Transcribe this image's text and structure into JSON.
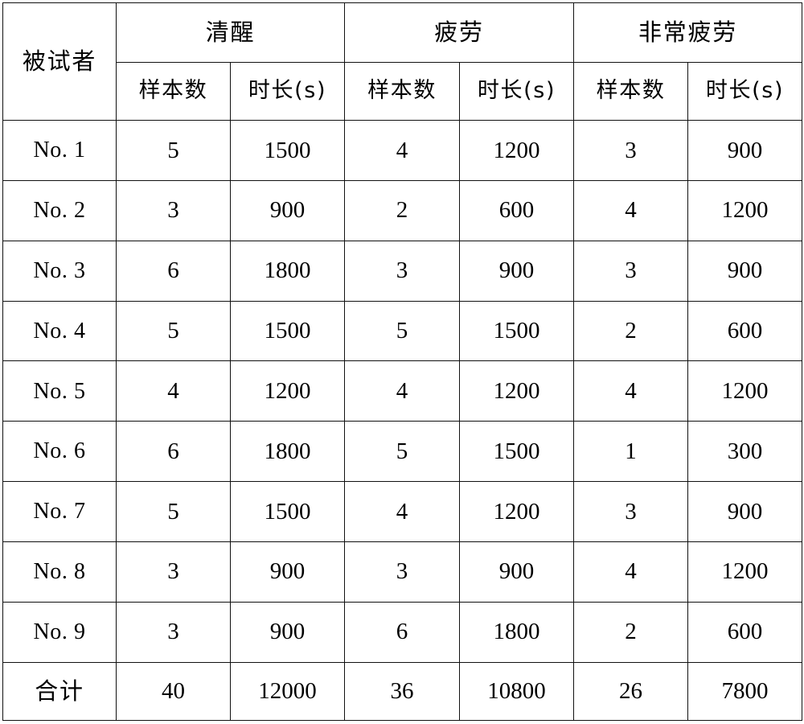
{
  "table": {
    "subject_header": "被试者",
    "groups": [
      {
        "label": "清醒",
        "sub": [
          "样本数",
          "时长(s)"
        ]
      },
      {
        "label": "疲劳",
        "sub": [
          "样本数",
          "时长(s)"
        ]
      },
      {
        "label": "非常疲劳",
        "sub": [
          "样本数",
          "时长(s)"
        ]
      }
    ],
    "rows": [
      {
        "subject": "No. 1",
        "awake_count": "5",
        "awake_duration": "1500",
        "fatigue_count": "4",
        "fatigue_duration": "1200",
        "severe_count": "3",
        "severe_duration": "900"
      },
      {
        "subject": "No. 2",
        "awake_count": "3",
        "awake_duration": "900",
        "fatigue_count": "2",
        "fatigue_duration": "600",
        "severe_count": "4",
        "severe_duration": "1200"
      },
      {
        "subject": "No. 3",
        "awake_count": "6",
        "awake_duration": "1800",
        "fatigue_count": "3",
        "fatigue_duration": "900",
        "severe_count": "3",
        "severe_duration": "900"
      },
      {
        "subject": "No. 4",
        "awake_count": "5",
        "awake_duration": "1500",
        "fatigue_count": "5",
        "fatigue_duration": "1500",
        "severe_count": "2",
        "severe_duration": "600"
      },
      {
        "subject": "No. 5",
        "awake_count": "4",
        "awake_duration": "1200",
        "fatigue_count": "4",
        "fatigue_duration": "1200",
        "severe_count": "4",
        "severe_duration": "1200"
      },
      {
        "subject": "No. 6",
        "awake_count": "6",
        "awake_duration": "1800",
        "fatigue_count": "5",
        "fatigue_duration": "1500",
        "severe_count": "1",
        "severe_duration": "300"
      },
      {
        "subject": "No. 7",
        "awake_count": "5",
        "awake_duration": "1500",
        "fatigue_count": "4",
        "fatigue_duration": "1200",
        "severe_count": "3",
        "severe_duration": "900"
      },
      {
        "subject": "No. 8",
        "awake_count": "3",
        "awake_duration": "900",
        "fatigue_count": "3",
        "fatigue_duration": "900",
        "severe_count": "4",
        "severe_duration": "1200"
      },
      {
        "subject": "No. 9",
        "awake_count": "3",
        "awake_duration": "900",
        "fatigue_count": "6",
        "fatigue_duration": "1800",
        "severe_count": "2",
        "severe_duration": "600"
      }
    ],
    "total": {
      "subject": "合计",
      "awake_count": "40",
      "awake_duration": "12000",
      "fatigue_count": "36",
      "fatigue_duration": "10800",
      "severe_count": "26",
      "severe_duration": "7800"
    }
  },
  "chart_data": {
    "type": "table",
    "title": "",
    "columns": [
      "被试者",
      "清醒 样本数",
      "清醒 时长(s)",
      "疲劳 样本数",
      "疲劳 时长(s)",
      "非常疲劳 样本数",
      "非常疲劳 时长(s)"
    ],
    "rows": [
      [
        "No. 1",
        5,
        1500,
        4,
        1200,
        3,
        900
      ],
      [
        "No. 2",
        3,
        900,
        2,
        600,
        4,
        1200
      ],
      [
        "No. 3",
        6,
        1800,
        3,
        900,
        3,
        900
      ],
      [
        "No. 4",
        5,
        1500,
        5,
        1500,
        2,
        600
      ],
      [
        "No. 5",
        4,
        1200,
        4,
        1200,
        4,
        1200
      ],
      [
        "No. 6",
        6,
        1800,
        5,
        1500,
        1,
        300
      ],
      [
        "No. 7",
        5,
        1500,
        4,
        1200,
        3,
        900
      ],
      [
        "No. 8",
        3,
        900,
        3,
        900,
        4,
        1200
      ],
      [
        "No. 9",
        3,
        900,
        6,
        1800,
        2,
        600
      ],
      [
        "合计",
        40,
        12000,
        36,
        10800,
        26,
        7800
      ]
    ]
  }
}
